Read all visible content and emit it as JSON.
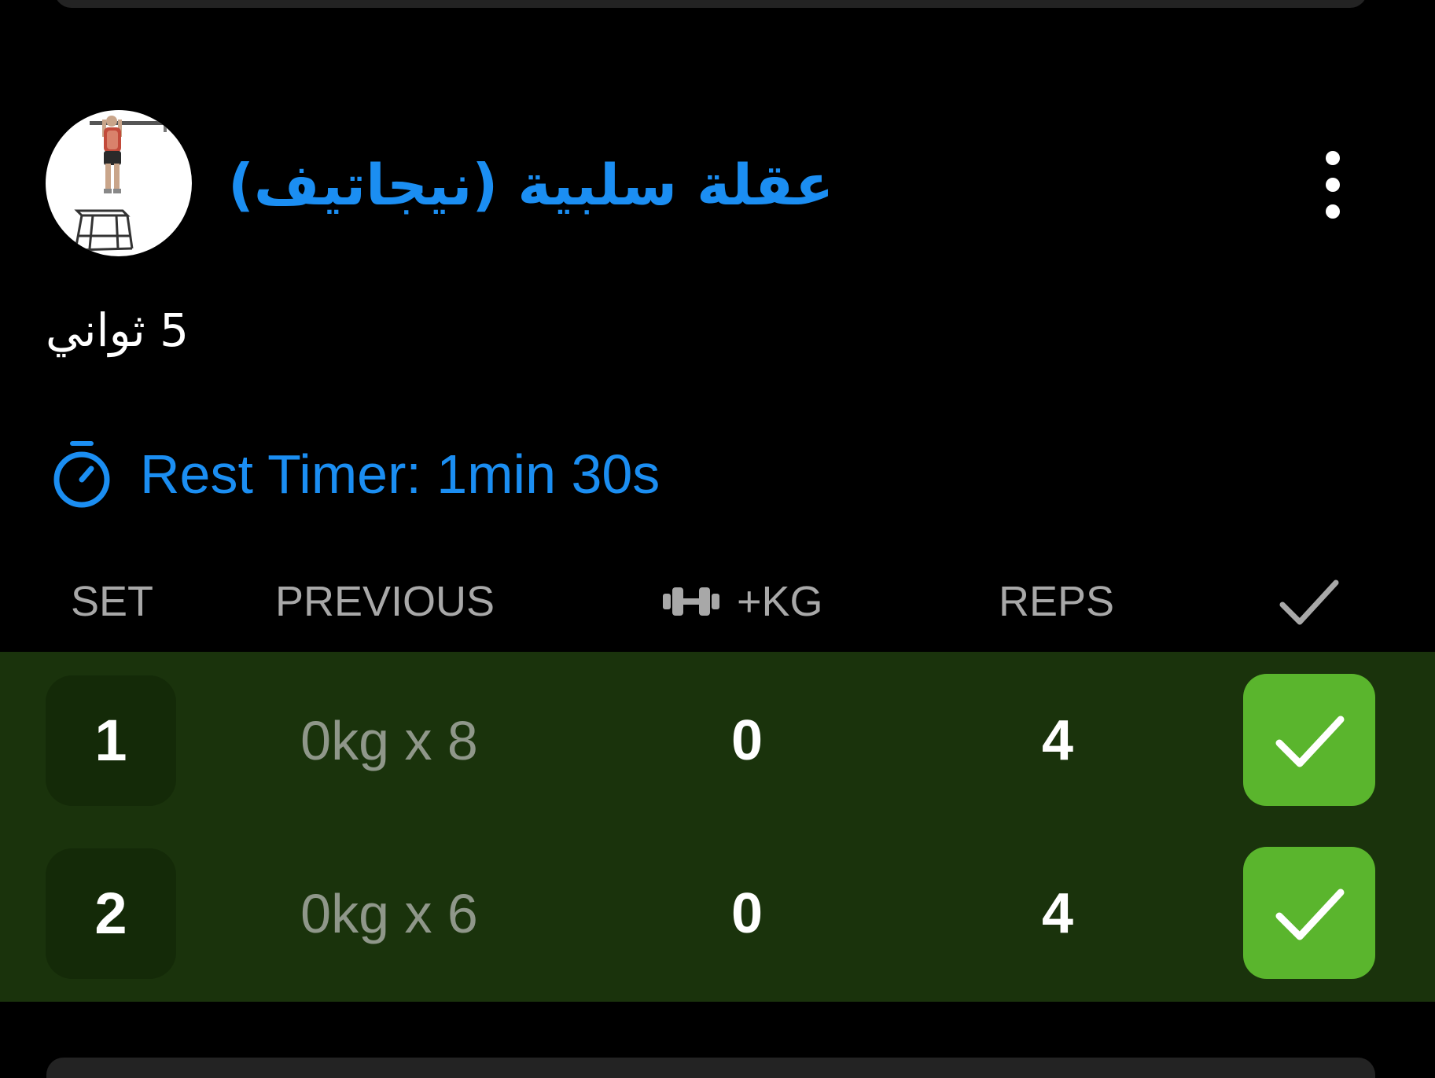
{
  "exercise": {
    "title": "عقلة سلبية (نيجاتيف)",
    "note": "5 ثواني",
    "image_icon": "pull-up-exercise-icon",
    "more_icon": "more-vertical-icon"
  },
  "rest_timer": {
    "label": "Rest Timer: 1min 30s",
    "icon": "stopwatch-icon"
  },
  "table": {
    "headers": {
      "set": "SET",
      "previous": "PREVIOUS",
      "kg": "+KG",
      "reps": "REPS"
    },
    "kg_icon": "dumbbell-icon",
    "check_icon": "checkmark-icon"
  },
  "sets": [
    {
      "set": "1",
      "previous": "0kg x 8",
      "kg": "0",
      "reps": "4",
      "completed": true
    },
    {
      "set": "2",
      "previous": "0kg x 6",
      "kg": "0",
      "reps": "4",
      "completed": true
    }
  ],
  "colors": {
    "background": "#000000",
    "accent_blue": "#1b8ef2",
    "completed_row": "#1a330c",
    "completed_check": "#5ab52d",
    "header_text": "#a8a8a8",
    "previous_text": "#8f978a"
  }
}
